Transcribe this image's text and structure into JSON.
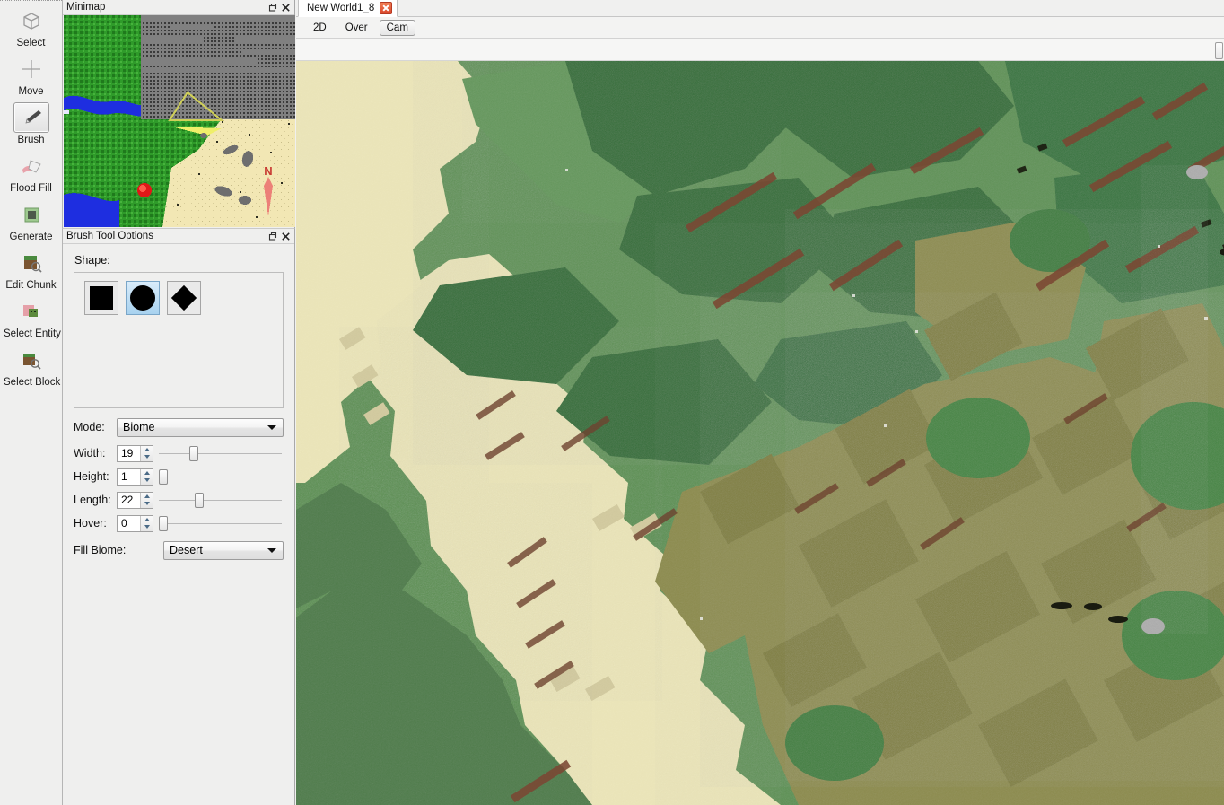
{
  "toolbar": {
    "items": [
      {
        "label": "Select",
        "icon": "cube-outline-icon",
        "selected": false
      },
      {
        "label": "Move",
        "icon": "move-crosshair-icon",
        "selected": false
      },
      {
        "label": "Brush",
        "icon": "brush-icon",
        "selected": true
      },
      {
        "label": "Flood Fill",
        "icon": "flood-fill-icon",
        "selected": false
      },
      {
        "label": "Generate",
        "icon": "generate-cube-icon",
        "selected": false
      },
      {
        "label": "Edit Chunk",
        "icon": "edit-chunk-icon",
        "selected": false
      },
      {
        "label": "Select Entity",
        "icon": "select-entity-icon",
        "selected": false
      },
      {
        "label": "Select Block",
        "icon": "select-block-icon",
        "selected": false
      }
    ]
  },
  "minimap": {
    "title": "Minimap",
    "restore_icon": "restore-window-icon",
    "close_icon": "close-icon",
    "compass_label": "N",
    "colors": {
      "grass": "#2f9b2a",
      "grass_dark": "#1f7a1c",
      "sand": "#f2e7b4",
      "water": "#1e2ee0",
      "unloaded": "#808080",
      "frustum": "#d8d860",
      "marker": "#e01818",
      "compass": "#e86a62"
    }
  },
  "brush_panel": {
    "title": "Brush Tool Options",
    "restore_icon": "restore-window-icon",
    "close_icon": "close-icon",
    "shape_label": "Shape:",
    "shapes": [
      {
        "name": "square",
        "selected": false
      },
      {
        "name": "circle",
        "selected": true
      },
      {
        "name": "diamond",
        "selected": false
      }
    ],
    "mode": {
      "label": "Mode:",
      "value": "Biome"
    },
    "sliders": [
      {
        "label": "Width:",
        "value": "19",
        "percent": 25
      },
      {
        "label": "Height:",
        "value": "1",
        "percent": 1
      },
      {
        "label": "Length:",
        "value": "22",
        "percent": 29
      },
      {
        "label": "Hover:",
        "value": "0",
        "percent": 0
      }
    ],
    "fill_biome": {
      "label": "Fill Biome:",
      "value": "Desert"
    }
  },
  "tabs": {
    "document": {
      "label": "New World1_8",
      "close_icon": "close-icon",
      "active": true
    }
  },
  "view_modes": [
    {
      "label": "2D",
      "active": false
    },
    {
      "label": "Over",
      "active": false
    },
    {
      "label": "Cam",
      "active": true
    }
  ],
  "toolstrip": {
    "edge_button_icon": "panel-toggle-icon"
  },
  "viewport": {
    "colors": {
      "grass_light": "#5d9153",
      "grass_mid": "#4b8346",
      "grass_dark": "#3a7238",
      "forest": "#2f6b33",
      "forest_dark": "#27592c",
      "savanna": "#7f8240",
      "desert_grass": "#8f8f4a",
      "dirt_path": "#7a4a33",
      "sand": "#e6e0b4",
      "sand_shadow": "#cfc9a0",
      "stone": "#9a9a9a"
    }
  }
}
